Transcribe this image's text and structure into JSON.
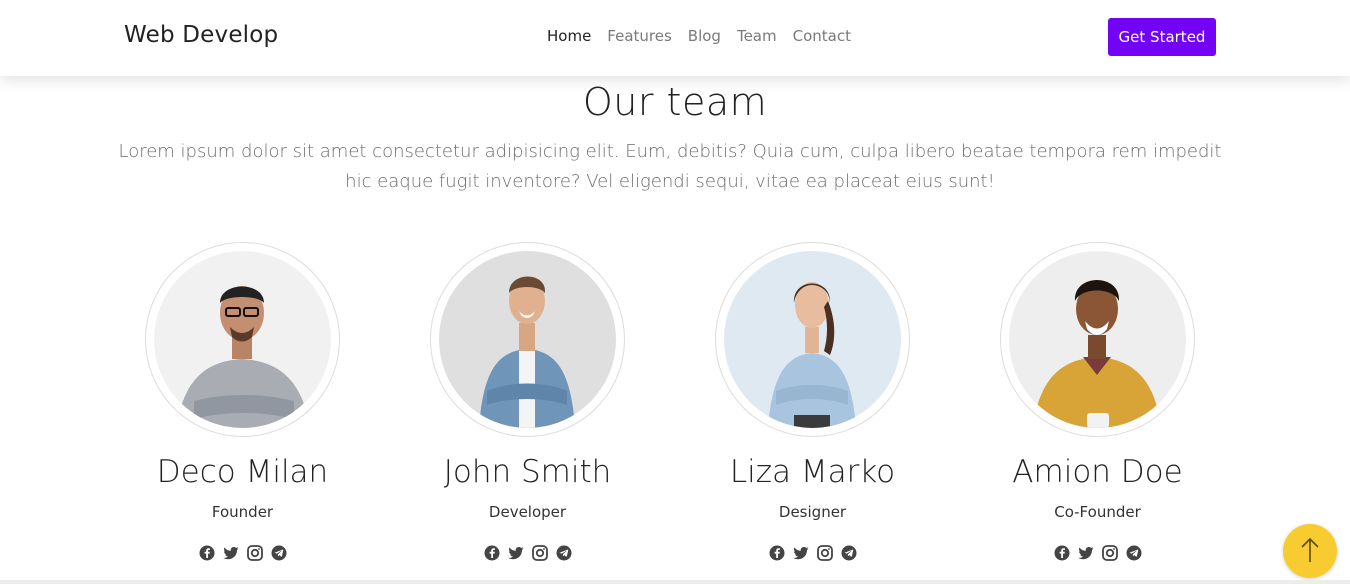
{
  "navbar": {
    "brand": "Web Develop",
    "links": [
      {
        "label": "Home",
        "active": true
      },
      {
        "label": "Features",
        "active": false
      },
      {
        "label": "Blog",
        "active": false
      },
      {
        "label": "Team",
        "active": false
      },
      {
        "label": "Contact",
        "active": false
      }
    ],
    "cta_label": "Get Started"
  },
  "section": {
    "title": "Our team",
    "description": "Lorem ipsum dolor sit amet consectetur adipisicing elit. Eum, debitis? Quia cum, culpa libero beatae tempora rem impedit hic eaque fugit inventore? Vel eligendi sequi, vitae ea placeat eius sunt!"
  },
  "team": [
    {
      "name": "Deco Milan",
      "role": "Founder",
      "socials": [
        "facebook-icon",
        "twitter-icon",
        "instagram-icon",
        "telegram-icon"
      ]
    },
    {
      "name": "John Smith",
      "role": "Developer",
      "socials": [
        "facebook-icon",
        "twitter-icon",
        "instagram-icon",
        "telegram-icon"
      ]
    },
    {
      "name": "Liza Marko",
      "role": "Designer",
      "socials": [
        "facebook-icon",
        "twitter-icon",
        "instagram-icon",
        "telegram-icon"
      ]
    },
    {
      "name": "Amion Doe",
      "role": "Co-Founder",
      "socials": [
        "facebook-icon",
        "twitter-icon",
        "instagram-icon",
        "telegram-icon"
      ]
    }
  ],
  "colors": {
    "accent": "#7303f5",
    "back_to_top": "#f8cc30",
    "text_dark": "#222222",
    "text_muted": "#7a7a7a"
  },
  "icons": {
    "back_to_top": "arrow-up-icon"
  }
}
